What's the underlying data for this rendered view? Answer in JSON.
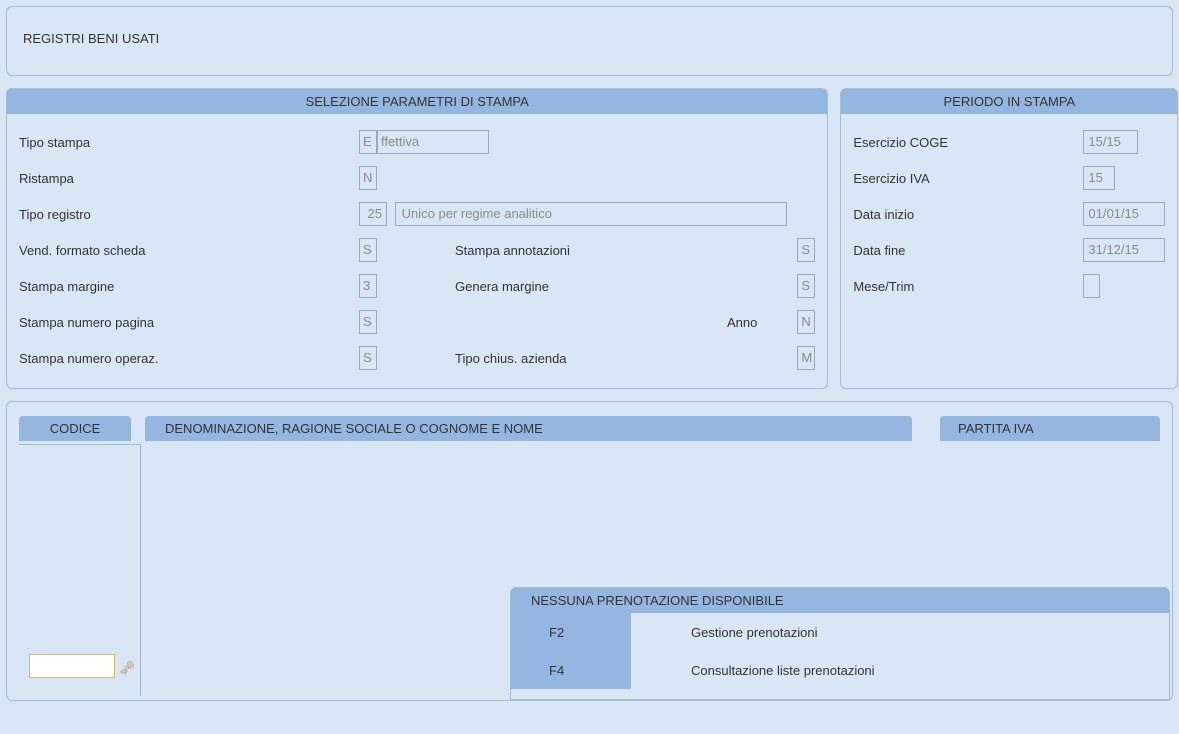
{
  "title": "REGISTRI BENI USATI",
  "params": {
    "header": "SELEZIONE PARAMETRI DI STAMPA",
    "tipo_stampa_label": "Tipo stampa",
    "tipo_stampa_code": "E",
    "tipo_stampa_desc": "ffettiva",
    "ristampa_label": "Ristampa",
    "ristampa_val": "N",
    "tipo_registro_label": "Tipo registro",
    "tipo_registro_num": "25",
    "tipo_registro_desc": "Unico per regime analitico",
    "vend_formato_label": "Vend. formato scheda",
    "vend_formato_val": "S",
    "stampa_annot_label": "Stampa annotazioni",
    "stampa_annot_val": "S",
    "stampa_margine_label": "Stampa margine",
    "stampa_margine_val": "3",
    "genera_margine_label": "Genera margine",
    "genera_margine_val": "S",
    "stampa_pagina_label": "Stampa numero pagina",
    "stampa_pagina_val": "S",
    "anno_label": "Anno",
    "anno_val": "N",
    "stampa_operaz_label": "Stampa numero operaz.",
    "stampa_operaz_val": "S",
    "tipo_chius_label": "Tipo chius. azienda",
    "tipo_chius_val": "M"
  },
  "period": {
    "header": "PERIODO IN STAMPA",
    "esercizio_coge_label": "Esercizio COGE",
    "esercizio_coge_val": "15/15",
    "esercizio_iva_label": "Esercizio IVA",
    "esercizio_iva_val": "15",
    "data_inizio_label": "Data inizio",
    "data_inizio_val": "01/01/15",
    "data_fine_label": "Data fine",
    "data_fine_val": "31/12/15",
    "mese_trim_label": "Mese/Trim",
    "mese_trim_val": ""
  },
  "tabs": {
    "codice": "CODICE",
    "denominazione": "DENOMINAZIONE, RAGIONE SOCIALE O COGNOME E NOME",
    "partita_iva": "PARTITA IVA"
  },
  "reservation": {
    "header": "NESSUNA PRENOTAZIONE DISPONIBILE",
    "f2_key": "F2",
    "f2_desc": "Gestione prenotazioni",
    "f4_key": "F4",
    "f4_desc": "Consultazione liste prenotazioni"
  }
}
